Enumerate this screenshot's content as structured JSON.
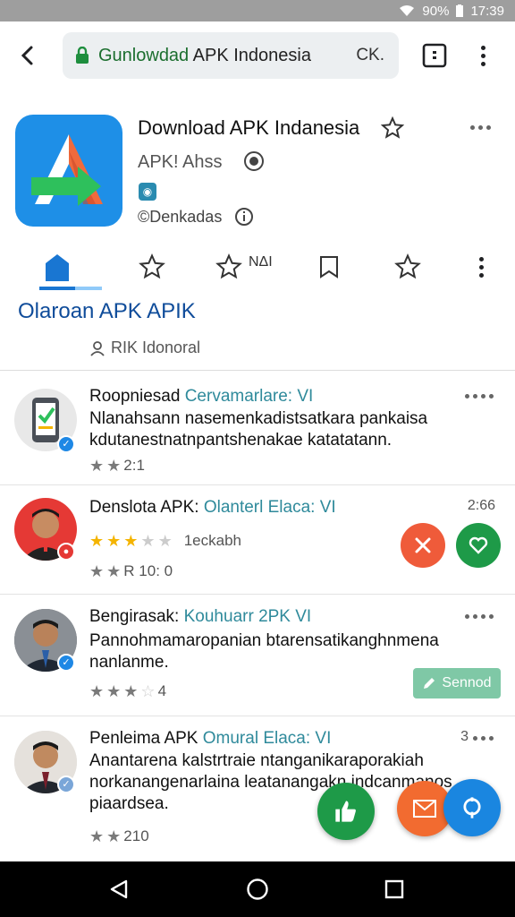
{
  "status": {
    "battery": "90%",
    "time": "17:39"
  },
  "toolbar": {
    "url_domain": "Gunlowdad",
    "url_rest": " APK Indonesia",
    "ok_label": "CK."
  },
  "app": {
    "title": "Download APK Indanesia",
    "developer": "APK! Ahss",
    "location": "©Denkadas",
    "section_title": "Olaroan APK APIK",
    "subline": "RIK  Idonoral",
    "action_label": "ΝΔΙ"
  },
  "reviews": [
    {
      "name": "Roopniesad",
      "highlight": "Cervamarlare: VI",
      "body": "Nlanahsann nasemenkadistsatkara pankaisa kdutanestnatnpantshenakae katatatann.",
      "rating": "2:1"
    },
    {
      "name": "Denslota APK:",
      "highlight": "Olanterl Elaca: VI",
      "time": "2:66",
      "tag": "1eckabh",
      "rating": "R 10: 0"
    },
    {
      "name": "Bengirasak:",
      "highlight": "Kouhuarr 2PK VI",
      "body": "Pannohmamaropanian btarensatikanghnmena nanlanme.",
      "rating": "4",
      "send_label": "Sennod"
    },
    {
      "name": "Penleima APK",
      "highlight": "Omural Elaca: VI",
      "time": "3",
      "body": "Anantarena kalstrtraie ntanganikaraporakiah norkanangenarlaina leatanangakn indcanmanos piaardsea.",
      "rating": "210"
    }
  ]
}
